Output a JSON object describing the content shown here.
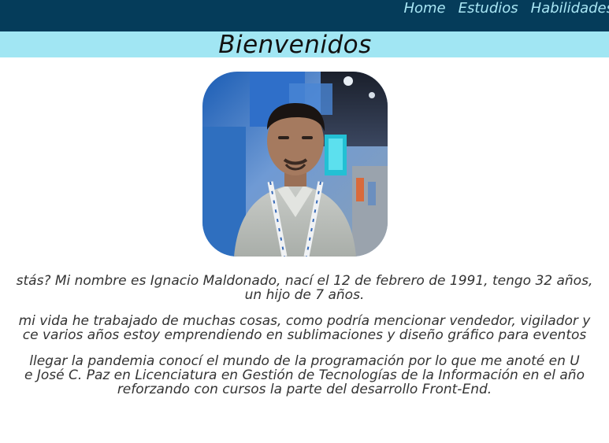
{
  "nav": {
    "items": [
      {
        "label": "Home"
      },
      {
        "label": "Estudios"
      },
      {
        "label": "Habilidades"
      }
    ]
  },
  "banner": {
    "title": "Bienvenidos"
  },
  "intro": {
    "paragraphs": [
      {
        "line1": "stás? Mi nombre es Ignacio Maldonado, nací el 12 de febrero de 1991, tengo 32 años,",
        "line2": "un hijo de 7 años."
      },
      {
        "line1": "mi vida he trabajado de muchas cosas, como podría mencionar vendedor, vigilador y",
        "line2": "ce varios años estoy emprendiendo en sublimaciones y diseño gráfico para eventos"
      },
      {
        "line1": "llegar la pandemia conocí el mundo de la programación por lo que me anoté en U",
        "line2": "e José C. Paz en Licenciatura en Gestión de Tecnologías de la Información en el año",
        "line3": "reforzando con cursos la parte del desarrollo Front-End."
      }
    ]
  },
  "colors": {
    "topbar": "#053c5a",
    "banner": "#a1e6f3",
    "nav_text": "#a9e6f4"
  },
  "icons": {
    "avatar": "profile-photo"
  }
}
